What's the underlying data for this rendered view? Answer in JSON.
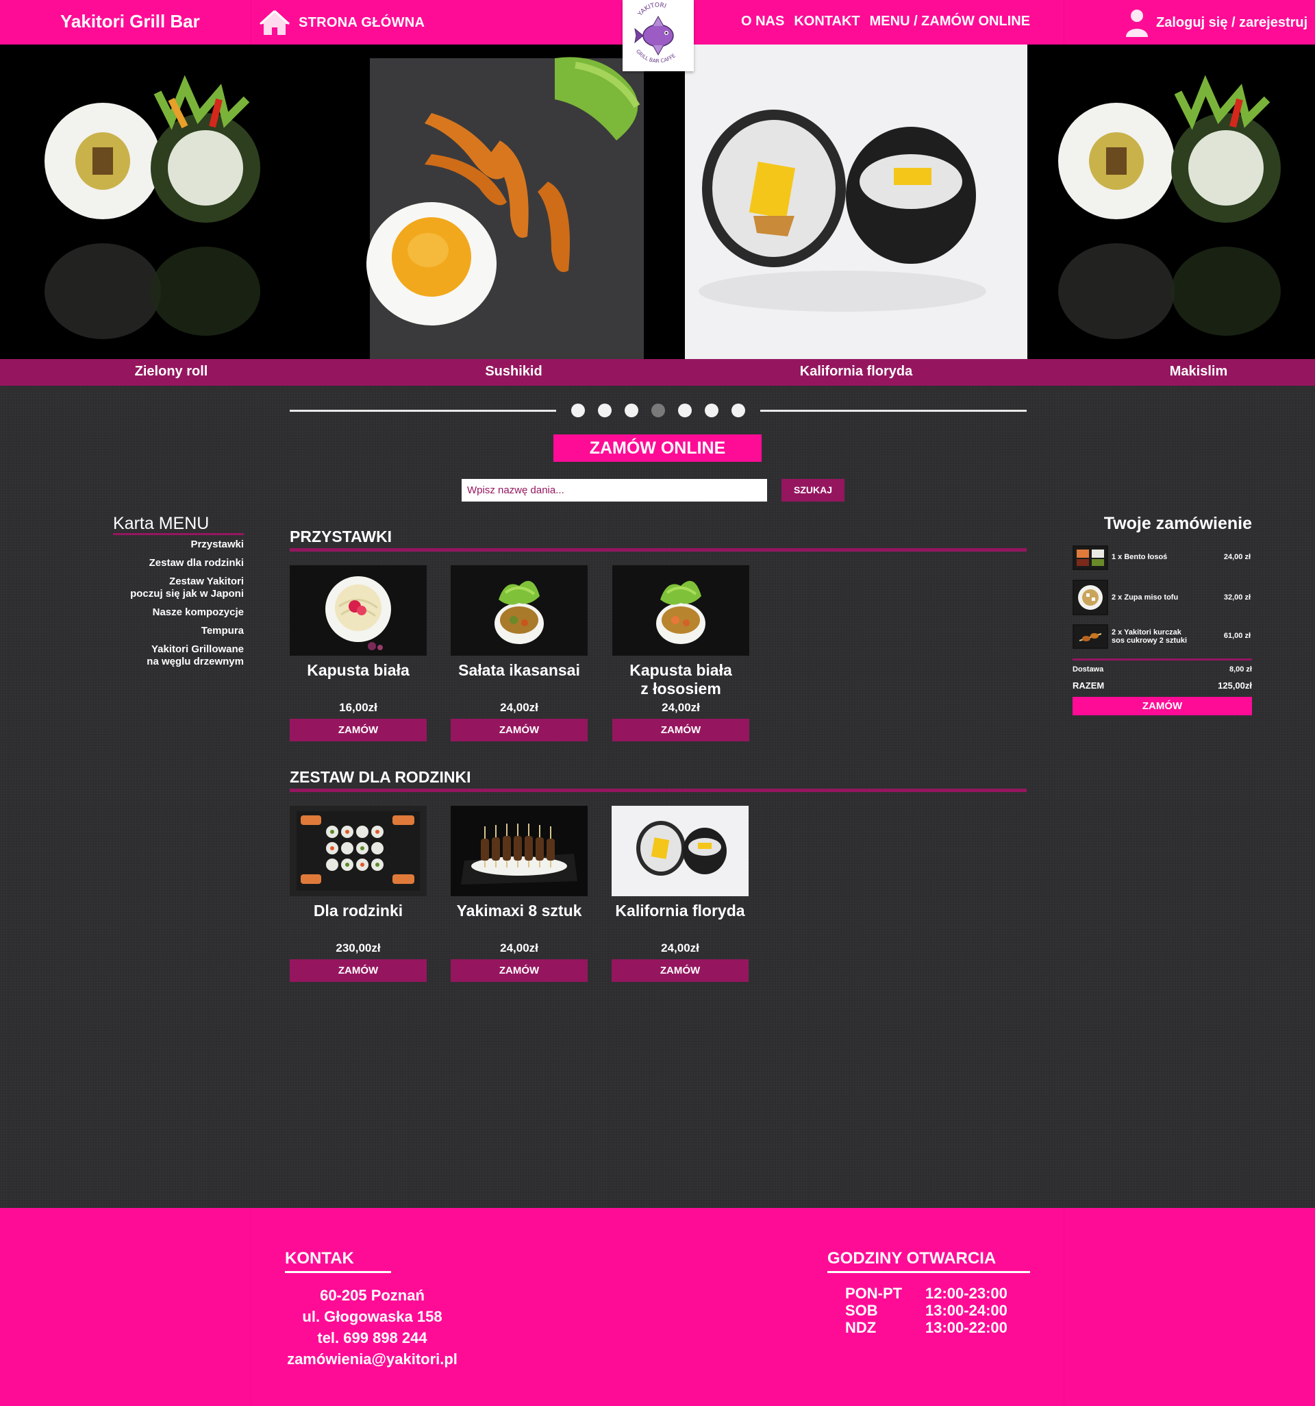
{
  "header": {
    "brand": "Yakitori Grill Bar",
    "home": "STRONA GŁÓWNA",
    "nav": [
      "O NAS",
      "KONTAKT",
      "MENU / ZAMÓW ONLINE"
    ],
    "login": "Zaloguj się / zarejestruj",
    "logo_top_text": "YAKITORI",
    "logo_bottom_text": "GRILL BAR CAFFE"
  },
  "slider": {
    "captions": [
      "Zielony roll",
      "Sushikid",
      "Kalifornia floryda",
      "Makislim"
    ],
    "dot_count": 7,
    "active_dot": 4
  },
  "order_online": "ZAMÓW ONLINE",
  "search": {
    "placeholder": "Wpisz nazwę dania...",
    "button": "SZUKAJ"
  },
  "menu": {
    "title": "Karta MENU",
    "items": [
      "Przystawki",
      "Zestaw dla rodzinki",
      "Zestaw Yakitori\npoczuj się jak w Japoni",
      "Nasze kompozycje",
      "Tempura",
      "Yakitori Grillowane\nna węglu drzewnym"
    ]
  },
  "sections": [
    {
      "title": "PRZYSTAWKI",
      "products": [
        {
          "name": "Kapusta biała",
          "price": "16,00zł",
          "button": "ZAMÓW",
          "image": "cabbage-salad-bowl"
        },
        {
          "name": "Sałata ikasansai",
          "price": "24,00zł",
          "button": "ZAMÓW",
          "image": "squid-salad-bowl"
        },
        {
          "name": "Kapusta biała\nz łososiem",
          "price": "24,00zł",
          "button": "ZAMÓW",
          "image": "cabbage-salmon-bowl"
        }
      ]
    },
    {
      "title": "ZESTAW DLA RODZINKI",
      "products": [
        {
          "name": "Dla rodzinki",
          "price": "230,00zł",
          "button": "ZAMÓW",
          "image": "family-sushi-platter"
        },
        {
          "name": "Yakimaxi  8 sztuk",
          "price": "24,00zł",
          "button": "ZAMÓW",
          "image": "yakitori-skewers"
        },
        {
          "name": "Kalifornia floryda",
          "price": "24,00zł",
          "button": "ZAMÓW",
          "image": "california-roll"
        }
      ]
    }
  ],
  "cart": {
    "title": "Twoje zamówienie",
    "items": [
      {
        "desc": "1 x Bento łosoś",
        "amount": "24,00 zł"
      },
      {
        "desc": "2 x Zupa miso tofu",
        "amount": "32,00 zł"
      },
      {
        "desc": "2 x Yakitori kurczak\nsos cukrowy 2 sztuki",
        "amount": "61,00 zł"
      }
    ],
    "delivery_label": "Dostawa",
    "delivery_amount": "8,00 zł",
    "total_label": "RAZEM",
    "total_amount": "125,00zł",
    "order_button": "ZAMÓW"
  },
  "footer": {
    "contact_title": "KONTAK",
    "contact_lines": [
      "60-205 Poznań",
      "ul. Głogowaska 158",
      "tel. 699 898 244",
      "zamówienia@yakitori.pl"
    ],
    "hours_title": "GODZINY OTWARCIA",
    "hours": [
      {
        "day": "PON-PT",
        "time": "12:00-23:00"
      },
      {
        "day": "SOB",
        "time": "13:00-24:00"
      },
      {
        "day": "NDZ",
        "time": "13:00-22:00"
      }
    ]
  },
  "colors": {
    "brand_pink": "#ff0c96",
    "accent_plum": "#95165f",
    "background": "#2e2e30"
  }
}
